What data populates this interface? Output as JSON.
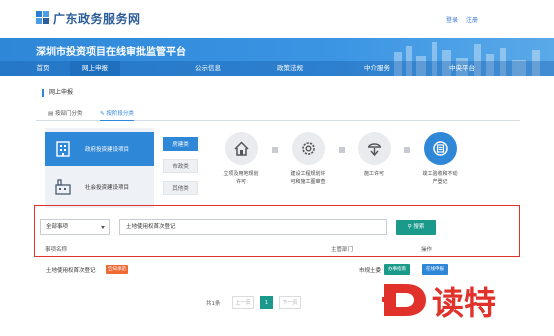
{
  "header": {
    "site_name": "广东政务服务网",
    "links": [
      "登录",
      "注册"
    ]
  },
  "banner": {
    "title": "深圳市投资项目在线审批监管平台"
  },
  "nav": {
    "items": [
      "首页",
      "网上申报",
      "公示信息",
      "政策法规",
      "中介服务",
      "中央平台"
    ],
    "active_index": 1
  },
  "page": {
    "breadcrumb": "网上申报",
    "tabs": [
      "按部门分类",
      "按阶段分类"
    ],
    "active_tab": 1
  },
  "categories": [
    {
      "label": "政府投资建设项目",
      "active": true,
      "icon": "building-icon"
    },
    {
      "label": "社会投资建设项目",
      "active": false,
      "icon": "factory-icon"
    }
  ],
  "subtypes": [
    {
      "label": "房建类",
      "active": true
    },
    {
      "label": "市政类",
      "active": false
    },
    {
      "label": "其他类",
      "active": false
    }
  ],
  "stages": [
    {
      "label_lines": [
        "立项及用地规划",
        "许可"
      ],
      "icon": "house-icon",
      "active": false
    },
    {
      "label_lines": [
        "建设工程规划许",
        "可和施工图审查"
      ],
      "icon": "gear-icon",
      "active": false
    },
    {
      "label_lines": [
        "施工许可"
      ],
      "icon": "hand-icon",
      "active": false
    },
    {
      "label_lines": [
        "竣工验收和不动",
        "产登记"
      ],
      "icon": "seal-icon",
      "active": true
    }
  ],
  "search": {
    "select_value": "全部事项",
    "query_value": "土地使用权首次登记",
    "button_label": "搜索",
    "columns": [
      "事项名称",
      "主管部门",
      "操作"
    ]
  },
  "results": [
    {
      "name": "土地使用权首次登记",
      "badge": "告知承诺",
      "department": "市规土委",
      "actions": [
        "办事指南",
        "在线申报"
      ]
    }
  ],
  "pager": {
    "summary": "共1条",
    "prev": "上一页",
    "current": "1",
    "next": "下一页"
  },
  "watermark": {
    "letter": "D",
    "text": "读特"
  },
  "colors": {
    "primary": "#2f87d8",
    "teal": "#1b9a8c",
    "highlight_border": "#e0312a",
    "badge": "#f06a36",
    "watermark": "#e0312a"
  }
}
